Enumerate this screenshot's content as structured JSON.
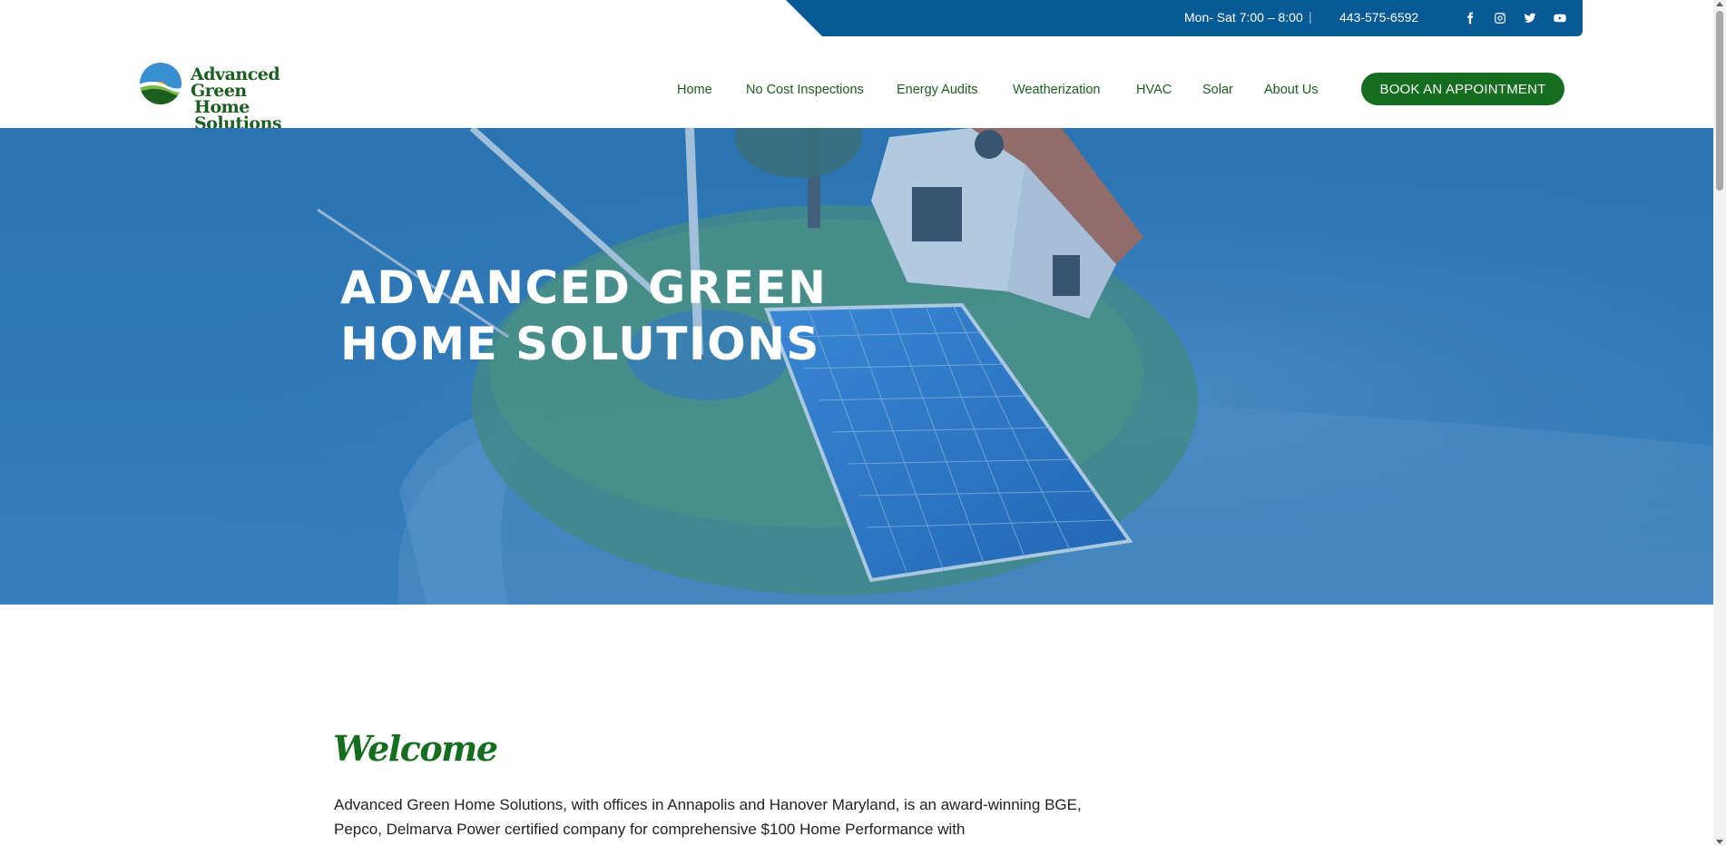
{
  "topbar": {
    "hours": "Mon- Sat 7:00 – 8:00",
    "separator": "|",
    "phone": "443-575-6592",
    "social": [
      "facebook-icon",
      "instagram-icon",
      "twitter-icon",
      "youtube-icon"
    ]
  },
  "header": {
    "logo_line1": "Advanced Green",
    "logo_line2": "Home Solutions",
    "nav": [
      "Home",
      "No Cost Inspections",
      "Energy Audits",
      "Weatherization",
      "HVAC",
      "Solar",
      "About Us"
    ],
    "cta_label": "BOOK AN APPOINTMENT"
  },
  "hero": {
    "title_line1": "ADVANCED GREEN",
    "title_line2": "HOME SOLUTIONS"
  },
  "welcome": {
    "heading": "Welcome",
    "text": "Advanced Green Home Solutions, with offices in Annapolis and Hanover Maryland, is an award-winning BGE, Pepco, Delmarva Power certified company for comprehensive $100 Home Performance with"
  },
  "colors": {
    "brand_blue": "#075a95",
    "brand_green": "#156d1f",
    "hero_overlay": "#2e79b8"
  }
}
